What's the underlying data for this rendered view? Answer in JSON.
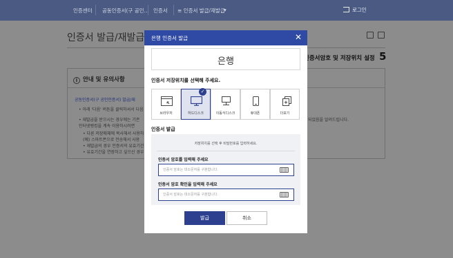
{
  "topnav": {
    "crumbs": [
      "인증센터",
      "공동인증서(구 공인…",
      "인증서",
      "≡ 인증서 발급/재발급"
    ],
    "login": "로그인"
  },
  "page": {
    "title": "인증서 발급/재발급",
    "step_text": "인증서암호 및 저장위치 설정",
    "step_num": "5"
  },
  "guide": {
    "heading": "안내 및 유의사항",
    "lines": [
      "공동인증서(구 공인인증서) 발급/재",
      "• 아래 '다음' 버튼을 클릭하셔서 다음",
      "• 재발급을 받으시는 경우에는 기존",
      "  인터넷뱅킹을 계속 이용하시려면",
      "• 다른 저장매체에 복사해서 사용하",
      "  (예) 스마트폰으로 전송해서 사용",
      "• 재발급의 경우 인증서의 유효기간",
      "• 유효기간을 연장하고 싶으신 경우"
    ],
    "right_text": "되었음을 알려드립니다."
  },
  "modal": {
    "title": "은행 인증서 발급",
    "bank_name": "은행",
    "location_prompt": "인증서 저장위치를 선택해 주세요.",
    "drives": [
      {
        "label": "브라우저",
        "icon": "browser-icon",
        "selected": false
      },
      {
        "label": "하드디스크",
        "icon": "hard-disk-icon",
        "selected": true
      },
      {
        "label": "이동식디스크",
        "icon": "removable-disk-icon",
        "selected": false
      },
      {
        "label": "휴대폰",
        "icon": "phone-icon",
        "selected": false
      },
      {
        "label": "더보기",
        "icon": "more-icon",
        "selected": false
      }
    ],
    "issue_label": "인증서 발급",
    "pw_info": "저장위치를 선택 후 비밀번호를 입력하세요.",
    "pw_label": "인증서 암호를 입력해 주세요",
    "pw_placeholder": "인증서 암호는 대소문자를 구분합니다.",
    "pw_confirm_label": "인증서 암호 확인을 입력해 주세요",
    "pw_confirm_placeholder": "인증서 암호는 대소문자를 구분합니다.",
    "issue_button": "발급",
    "cancel_button": "취소"
  },
  "colors": {
    "modal_header": "#2f4aa5",
    "primary_button": "#2d3f8f",
    "nav_bar": "#4a5a83"
  }
}
